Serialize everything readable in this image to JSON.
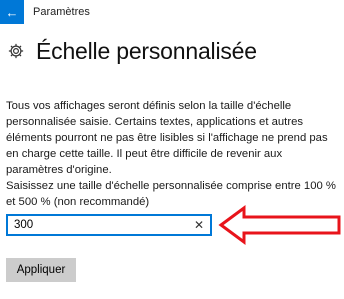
{
  "window": {
    "app_title": "Paramètres",
    "back_icon": "back-arrow-icon"
  },
  "header": {
    "icon": "gear-icon",
    "title": "Échelle personnalisée"
  },
  "content": {
    "description": "Tous vos affichages seront définis selon la taille d'échelle personnalisée saisie. Certains textes, applications et autres éléments pourront ne pas être lisibles si l'affichage ne prend pas en charge cette taille. Il peut être difficile de revenir aux paramètres d'origine.",
    "prompt": "Saisissez une taille d'échelle personnalisée comprise entre 100 % et 500 % (non recommandé)",
    "scale_input": {
      "value": "300",
      "clear_icon": "close-icon"
    },
    "apply_button": "Appliquer"
  },
  "annotation": {
    "arrow_color": "#e8141b"
  },
  "colors": {
    "accent": "#0078d7",
    "button_bg": "#cccccc"
  }
}
